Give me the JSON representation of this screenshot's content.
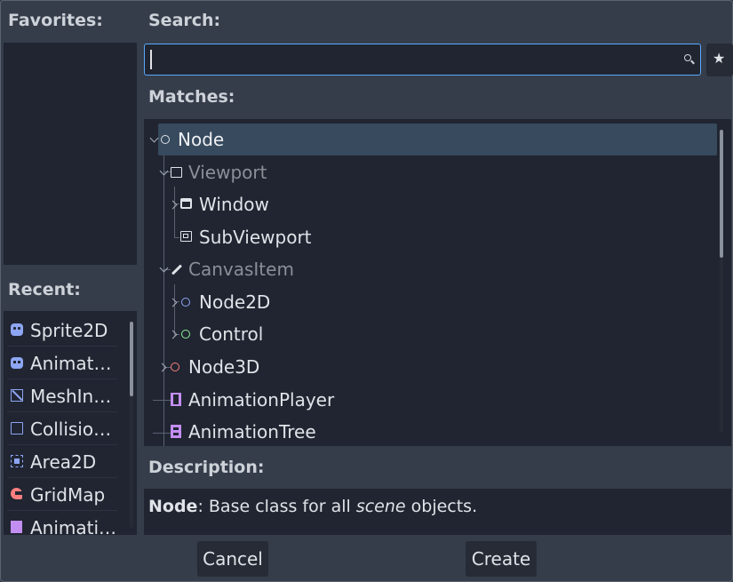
{
  "labels": {
    "favorites": "Favorites:",
    "search": "Search:",
    "matches": "Matches:",
    "recent": "Recent:",
    "description": "Description:"
  },
  "search": {
    "value": "",
    "placeholder": ""
  },
  "tree": [
    {
      "label": "Node",
      "icon": "node-circle-icon",
      "selected": true,
      "dimmed": false
    },
    {
      "label": "Viewport",
      "icon": "viewport-icon",
      "selected": false,
      "dimmed": true
    },
    {
      "label": "Window",
      "icon": "window-icon",
      "selected": false,
      "dimmed": false
    },
    {
      "label": "SubViewport",
      "icon": "subviewport-icon",
      "selected": false,
      "dimmed": false
    },
    {
      "label": "CanvasItem",
      "icon": "pencil-icon",
      "selected": false,
      "dimmed": true
    },
    {
      "label": "Node2D",
      "icon": "node2d-circle-icon",
      "selected": false,
      "dimmed": false
    },
    {
      "label": "Control",
      "icon": "control-circle-icon",
      "selected": false,
      "dimmed": false
    },
    {
      "label": "Node3D",
      "icon": "node3d-circle-icon",
      "selected": false,
      "dimmed": false
    },
    {
      "label": "AnimationPlayer",
      "icon": "film-icon",
      "selected": false,
      "dimmed": false
    },
    {
      "label": "AnimationTree",
      "icon": "film-tree-icon",
      "selected": false,
      "dimmed": false
    }
  ],
  "recent": [
    {
      "label": "Sprite2D",
      "icon": "sprite-icon"
    },
    {
      "label": "Animat…",
      "icon": "animated-sprite-icon"
    },
    {
      "label": "MeshIn…",
      "icon": "mesh-instance-icon"
    },
    {
      "label": "Collisio…",
      "icon": "collision-shape-icon"
    },
    {
      "label": "Area2D",
      "icon": "area2d-icon"
    },
    {
      "label": "GridMap",
      "icon": "gridmap-icon"
    },
    {
      "label": "Animati…",
      "icon": "animation-icon"
    }
  ],
  "description": {
    "name": "Node",
    "prefix": ": Base class for all ",
    "emphasis": "scene",
    "suffix": " objects."
  },
  "buttons": {
    "cancel": "Cancel",
    "create": "Create"
  },
  "colors": {
    "accent": "#57a9ff",
    "node2d": "#8da5f3",
    "control": "#8eef97",
    "node3d": "#fc7f7f",
    "animation": "#c38ef1",
    "gridmap": "#fc7f7f"
  }
}
